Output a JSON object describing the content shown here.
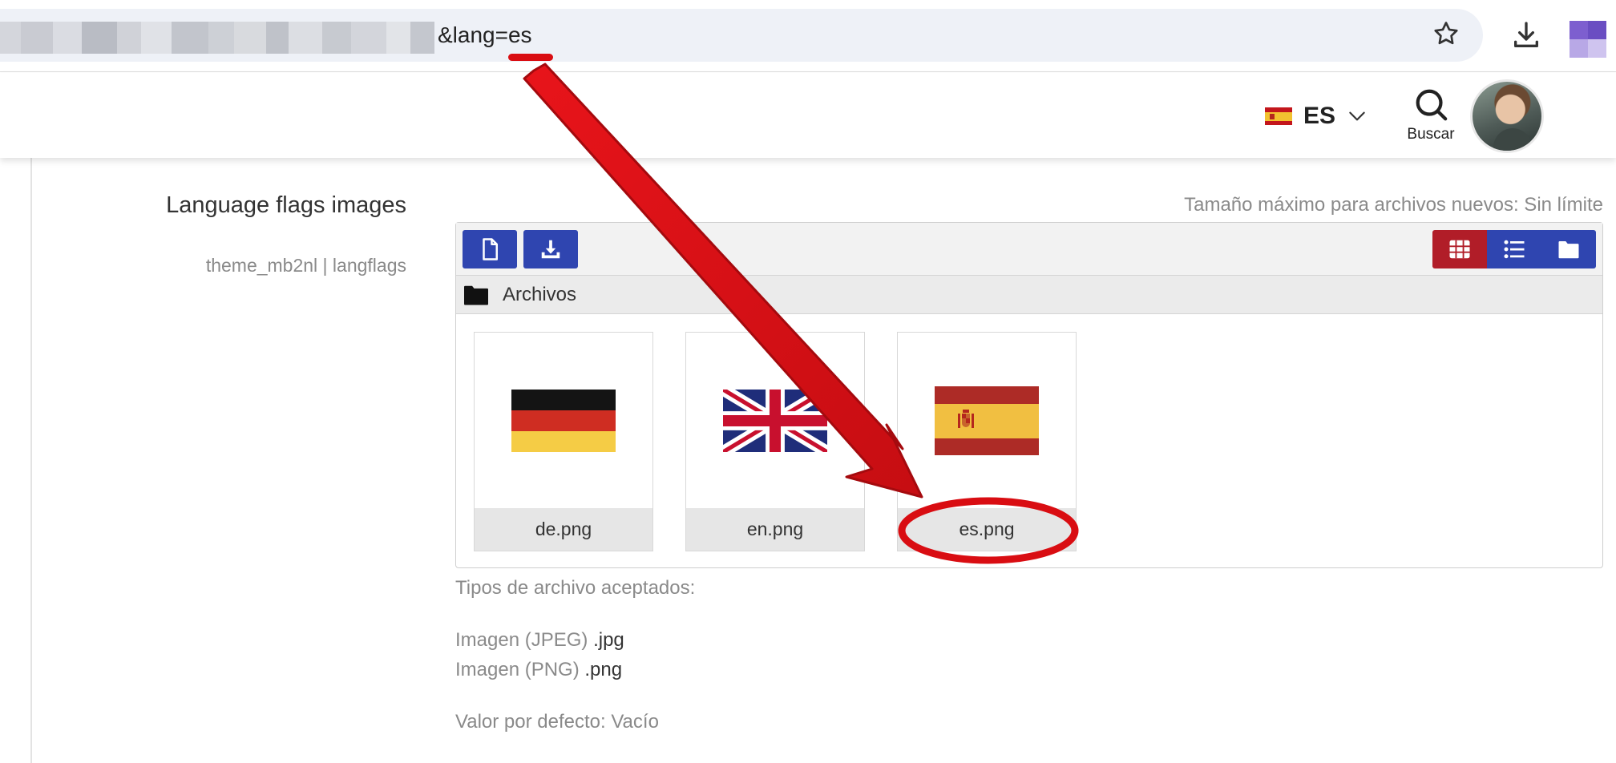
{
  "browser": {
    "url_visible_text": "&lang=es",
    "url_blur_colors": [
      "#d4d6dc",
      "#c9cbd2",
      "#dadce2",
      "#b9bcc4",
      "#d0d2d8",
      "#e0e2e7",
      "#c2c5cc",
      "#cdd0d6",
      "#d8dade",
      "#bfc2c9",
      "#dcdee3",
      "#c7cad0",
      "#d3d5db",
      "#e2e4e8",
      "#c4c7ce"
    ]
  },
  "header": {
    "language_code": "ES",
    "search_label": "Buscar"
  },
  "field": {
    "title": "Language flags images",
    "setting_name": "theme_mb2nl | langflags",
    "max_size_text": "Tamaño máximo para archivos nuevos: Sin límite"
  },
  "filepicker": {
    "path_label": "Archivos",
    "files": [
      {
        "name": "de.png",
        "flag": "germany-flag"
      },
      {
        "name": "en.png",
        "flag": "uk-flag"
      },
      {
        "name": "es.png",
        "flag": "spain-flag"
      }
    ],
    "active_view": "grid"
  },
  "accepted": {
    "heading": "Tipos de archivo aceptados:",
    "types": [
      {
        "label": "Imagen (JPEG)",
        "ext": ".jpg"
      },
      {
        "label": "Imagen (PNG)",
        "ext": ".png"
      }
    ],
    "default_value": "Valor por defecto: Vacío"
  },
  "colors": {
    "primary_button": "#2f45b0",
    "active_view_button": "#b11d28",
    "annotation_red": "#d90d12"
  }
}
